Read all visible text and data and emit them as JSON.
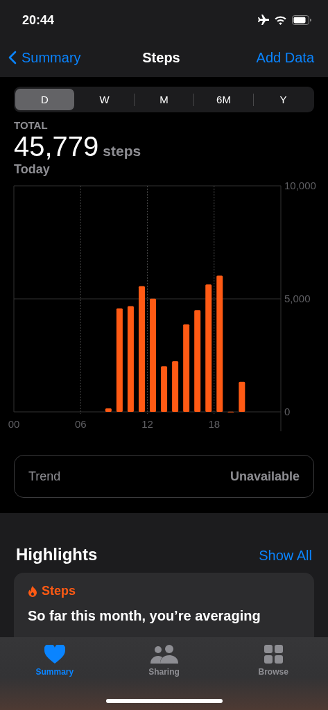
{
  "status_bar": {
    "time": "20:44"
  },
  "nav": {
    "back": "Summary",
    "title": "Steps",
    "action": "Add Data"
  },
  "ranges": [
    {
      "label": "D",
      "selected": true
    },
    {
      "label": "W",
      "selected": false
    },
    {
      "label": "M",
      "selected": false
    },
    {
      "label": "6M",
      "selected": false
    },
    {
      "label": "Y",
      "selected": false
    }
  ],
  "total": {
    "label": "TOTAL",
    "value": "45,779",
    "unit": "steps",
    "period": "Today"
  },
  "chart_data": {
    "type": "bar",
    "x": [
      8.5,
      9.5,
      10.5,
      11.5,
      12.5,
      13.5,
      14.5,
      15.5,
      16.5,
      17.5,
      18.5,
      19.5,
      20.5
    ],
    "xlim": [
      0,
      24
    ],
    "series": [
      {
        "color": "#ff5a14",
        "values": [
          150,
          4580,
          4680,
          5560,
          5010,
          2020,
          2240,
          3870,
          4500,
          5640,
          6030,
          10,
          1330
        ]
      }
    ],
    "xticks": [
      {
        "value": 0,
        "label": "00"
      },
      {
        "value": 6,
        "label": "06"
      },
      {
        "value": 12,
        "label": "12"
      },
      {
        "value": 18,
        "label": "18"
      }
    ],
    "ylim": [
      0,
      10000
    ],
    "grid": true,
    "ref_lines": [
      {
        "axis": "y",
        "value": 5000
      }
    ],
    "yticks": [
      {
        "value": 0,
        "label": "0"
      },
      {
        "value": 5000,
        "label": "5,000"
      },
      {
        "value": 10000,
        "label": "10,000"
      }
    ]
  },
  "trend": {
    "label": "Trend",
    "value": "Unavailable"
  },
  "highlights": {
    "title": "Highlights",
    "action": "Show All",
    "card": {
      "category": "Steps",
      "text": "So far this month, you’re averaging"
    }
  },
  "tab_bar": [
    {
      "label": "Summary",
      "kind": "heart",
      "selected": true
    },
    {
      "label": "Sharing",
      "kind": "people",
      "selected": false
    },
    {
      "label": "Browse",
      "kind": "grid",
      "selected": false
    }
  ]
}
